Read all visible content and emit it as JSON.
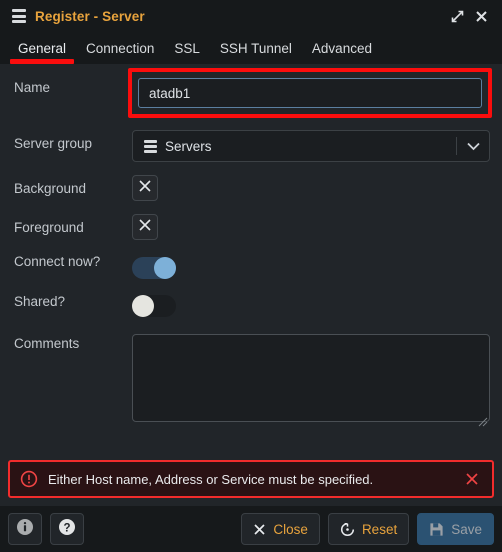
{
  "window": {
    "title": "Register - Server",
    "icon": "server-stack-icon",
    "controls": {
      "maximize": "maximize-icon",
      "close": "close-icon"
    }
  },
  "tabs": [
    {
      "label": "General",
      "active": true
    },
    {
      "label": "Connection",
      "active": false
    },
    {
      "label": "SSL",
      "active": false
    },
    {
      "label": "SSH Tunnel",
      "active": false
    },
    {
      "label": "Advanced",
      "active": false
    }
  ],
  "form": {
    "name": {
      "label": "Name",
      "value": "atadb1",
      "placeholder": "",
      "highlighted": true
    },
    "server_group": {
      "label": "Server group",
      "value": "Servers",
      "icon": "server-stack-icon",
      "caret": "chevron-down-icon"
    },
    "background": {
      "label": "Background",
      "button_icon": "clear-color-x-icon"
    },
    "foreground": {
      "label": "Foreground",
      "button_icon": "clear-color-x-icon"
    },
    "connect_now": {
      "label": "Connect now?",
      "state": "on"
    },
    "shared": {
      "label": "Shared?",
      "state": "off"
    },
    "comments": {
      "label": "Comments",
      "value": "",
      "placeholder": ""
    }
  },
  "error": {
    "icon": "error-circle-icon",
    "message": "Either Host name, Address or Service must be specified.",
    "close_icon": "close-icon"
  },
  "footer": {
    "info_icon": "info-circle-icon",
    "help_icon": "help-circle-icon",
    "close_label": "Close",
    "close_icon": "x-icon",
    "reset_label": "Reset",
    "reset_icon": "reset-arrow-icon",
    "save_label": "Save",
    "save_icon": "floppy-disk-icon"
  },
  "colors": {
    "accent_orange": "#e8a33d",
    "highlight_red": "#fb0d0d",
    "error_red": "#f22c2c",
    "toggle_on": "#7db0d8",
    "primary_button": "#2b5272"
  }
}
